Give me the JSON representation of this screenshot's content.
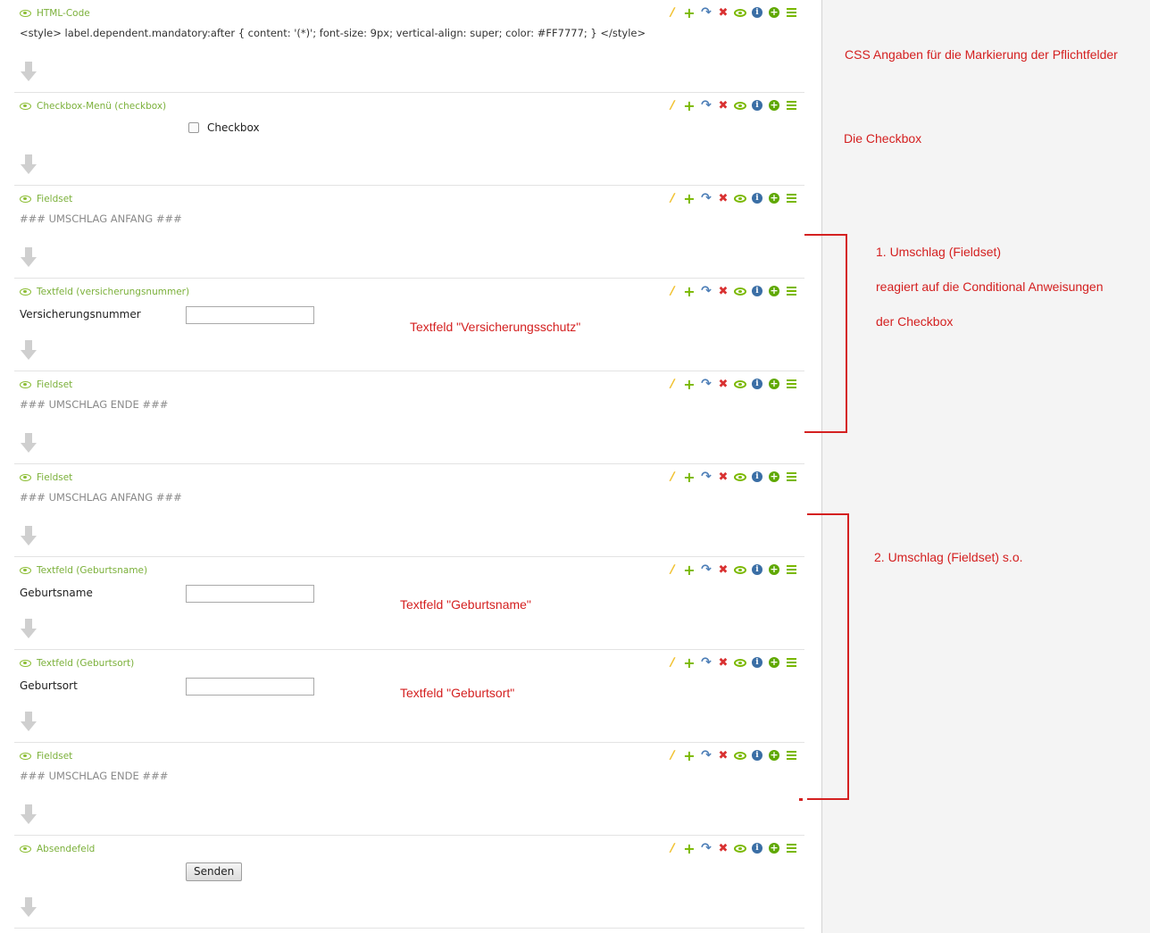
{
  "blocks": [
    {
      "type_label": "HTML-Code",
      "content": "<style> label.dependent.mandatory:after { content: '(*)'; font-size: 9px; vertical-align: super; color: #FF7777; } </style>"
    },
    {
      "type_label": "Checkbox-Menü (checkbox)",
      "checkbox_label": "Checkbox"
    },
    {
      "type_label": "Fieldset",
      "content": "### UMSCHLAG ANFANG ###"
    },
    {
      "type_label": "Textfeld (versicherungsnummer)",
      "field_label": "Versicherungsnummer",
      "value": ""
    },
    {
      "type_label": "Fieldset",
      "content": "### UMSCHLAG ENDE ###"
    },
    {
      "type_label": "Fieldset",
      "content": "### UMSCHLAG ANFANG ###"
    },
    {
      "type_label": "Textfeld (Geburtsname)",
      "field_label": "Geburtsname",
      "value": ""
    },
    {
      "type_label": "Textfeld (Geburtsort)",
      "field_label": "Geburtsort",
      "value": ""
    },
    {
      "type_label": "Fieldset",
      "content": "### UMSCHLAG ENDE ###"
    },
    {
      "type_label": "Absendefeld",
      "button_label": "Senden"
    }
  ],
  "annotations": {
    "css_note": "CSS Angaben für die Markierung der Pflichtfelder",
    "checkbox_note": "Die Checkbox",
    "versicherung_note": "Textfeld \"Versicherungsschutz\"",
    "umschlag1_line1": "1. Umschlag (Fieldset)",
    "umschlag1_line2": "reagiert auf die Conditional Anweisungen",
    "umschlag1_line3": "der Checkbox",
    "geburtsname_note": "Textfeld \"Geburtsname\"",
    "geburtsort_note": "Textfeld \"Geburtsort\"",
    "umschlag2_line1": "2. Umschlag (Fieldset) s.o."
  },
  "icons": [
    "eye-icon",
    "pencil-icon",
    "add-icon",
    "move-icon",
    "delete-icon",
    "visibility-icon",
    "info-icon",
    "insert-icon",
    "menu-icon",
    "arrow-down-icon"
  ],
  "colors": {
    "accent_green": "#7bb03a",
    "annotation_red": "#d42020"
  }
}
